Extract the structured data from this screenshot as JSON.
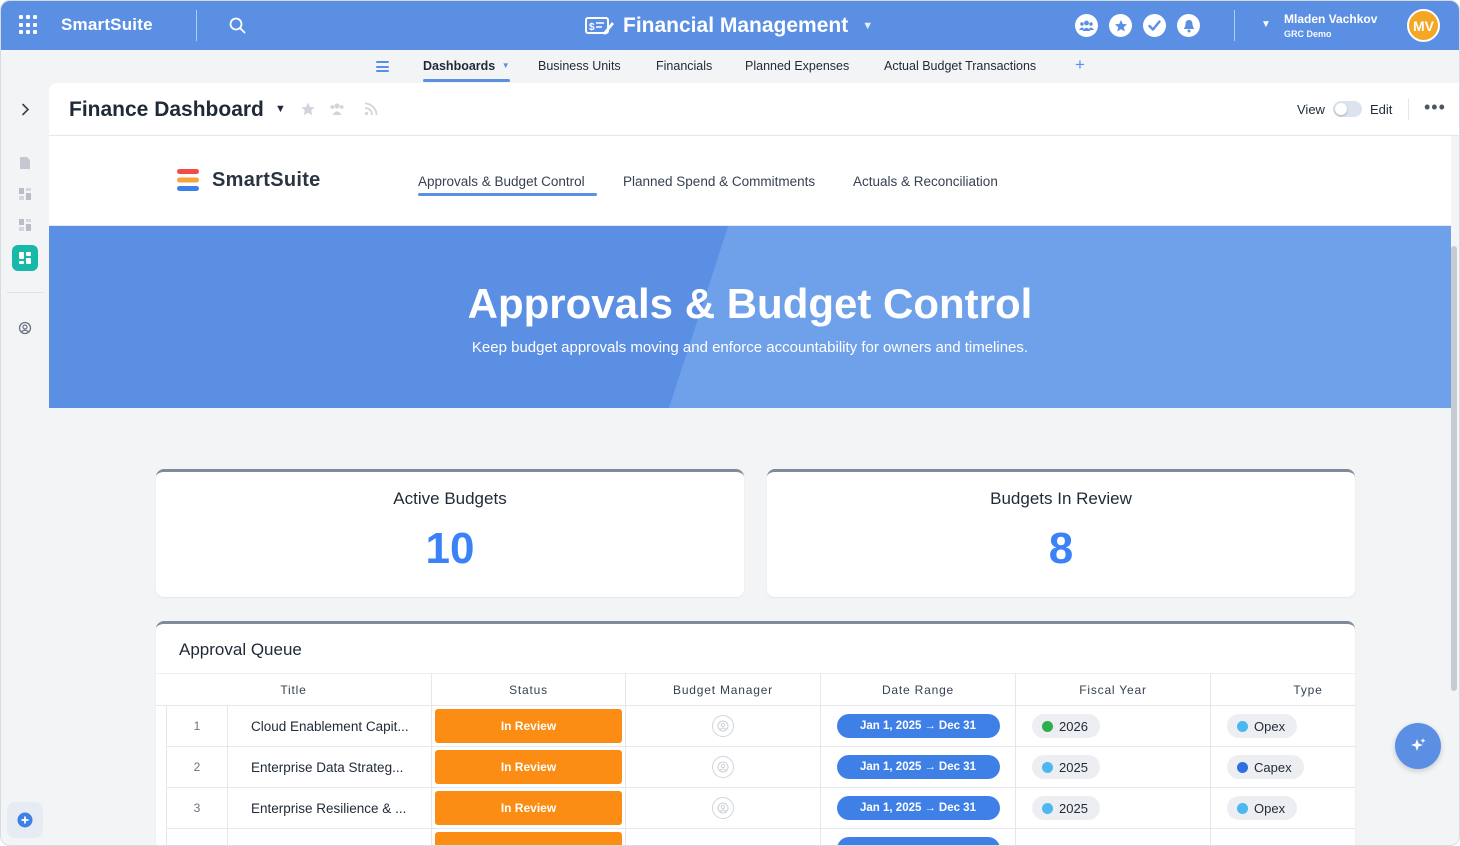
{
  "topbar": {
    "brand": "SmartSuite",
    "app_title": "Financial Management",
    "user_name": "Mladen Vachkov",
    "user_org": "GRC Demo",
    "avatar_initials": "MV",
    "accent": "#5b8fe3"
  },
  "subnav": {
    "tabs": [
      {
        "label": "Dashboards"
      },
      {
        "label": "Business Units"
      },
      {
        "label": "Financials"
      },
      {
        "label": "Planned Expenses"
      },
      {
        "label": "Actual Budget Transactions"
      }
    ],
    "add": "+"
  },
  "dashboard": {
    "title": "Finance Dashboard",
    "view_label": "View",
    "edit_label": "Edit"
  },
  "hero": {
    "logo_text": "SmartSuite",
    "tabs": [
      {
        "label": "Approvals & Budget Control"
      },
      {
        "label": "Planned Spend & Commitments"
      },
      {
        "label": "Actuals & Reconciliation"
      }
    ],
    "banner_title": "Approvals & Budget Control",
    "banner_subtitle": "Keep budget approvals moving and enforce accountability for owners and timelines."
  },
  "kpis": [
    {
      "label": "Active Budgets",
      "value": "10"
    },
    {
      "label": "Budgets In Review",
      "value": "8"
    }
  ],
  "queue": {
    "title": "Approval Queue",
    "columns": [
      "Title",
      "Status",
      "Budget Manager",
      "Date Range",
      "Fiscal Year",
      "Type"
    ],
    "rows": [
      {
        "num": "1",
        "title": "Cloud Enablement Capit...",
        "status": "In Review",
        "date_start": "Jan 1, 2025",
        "date_end": "Dec 31",
        "year": "2026",
        "year_color": "#2eae4e",
        "type": "Opex",
        "type_color": "#4bb8f0"
      },
      {
        "num": "2",
        "title": "Enterprise Data Strateg...",
        "status": "In Review",
        "date_start": "Jan 1, 2025",
        "date_end": "Dec 31",
        "year": "2025",
        "year_color": "#4bb8f0",
        "type": "Capex",
        "type_color": "#2f6fe0"
      },
      {
        "num": "3",
        "title": "Enterprise Resilience & ...",
        "status": "In Review",
        "date_start": "Jan 1, 2025",
        "date_end": "Dec 31",
        "year": "2025",
        "year_color": "#4bb8f0",
        "type": "Opex",
        "type_color": "#4bb8f0"
      }
    ]
  },
  "icons": {
    "apps": "apps-grid-icon",
    "search": "search-icon",
    "app_logo": "finance-app-icon",
    "team": "team-icon",
    "favorite": "star-icon",
    "tasks": "check-icon",
    "notifications": "bell-icon",
    "ai": "sparkle-icon"
  },
  "colors": {
    "status_in_review": "#fb8c14",
    "date_pill": "#3f80e6",
    "kpi_value": "#3b82f6"
  }
}
